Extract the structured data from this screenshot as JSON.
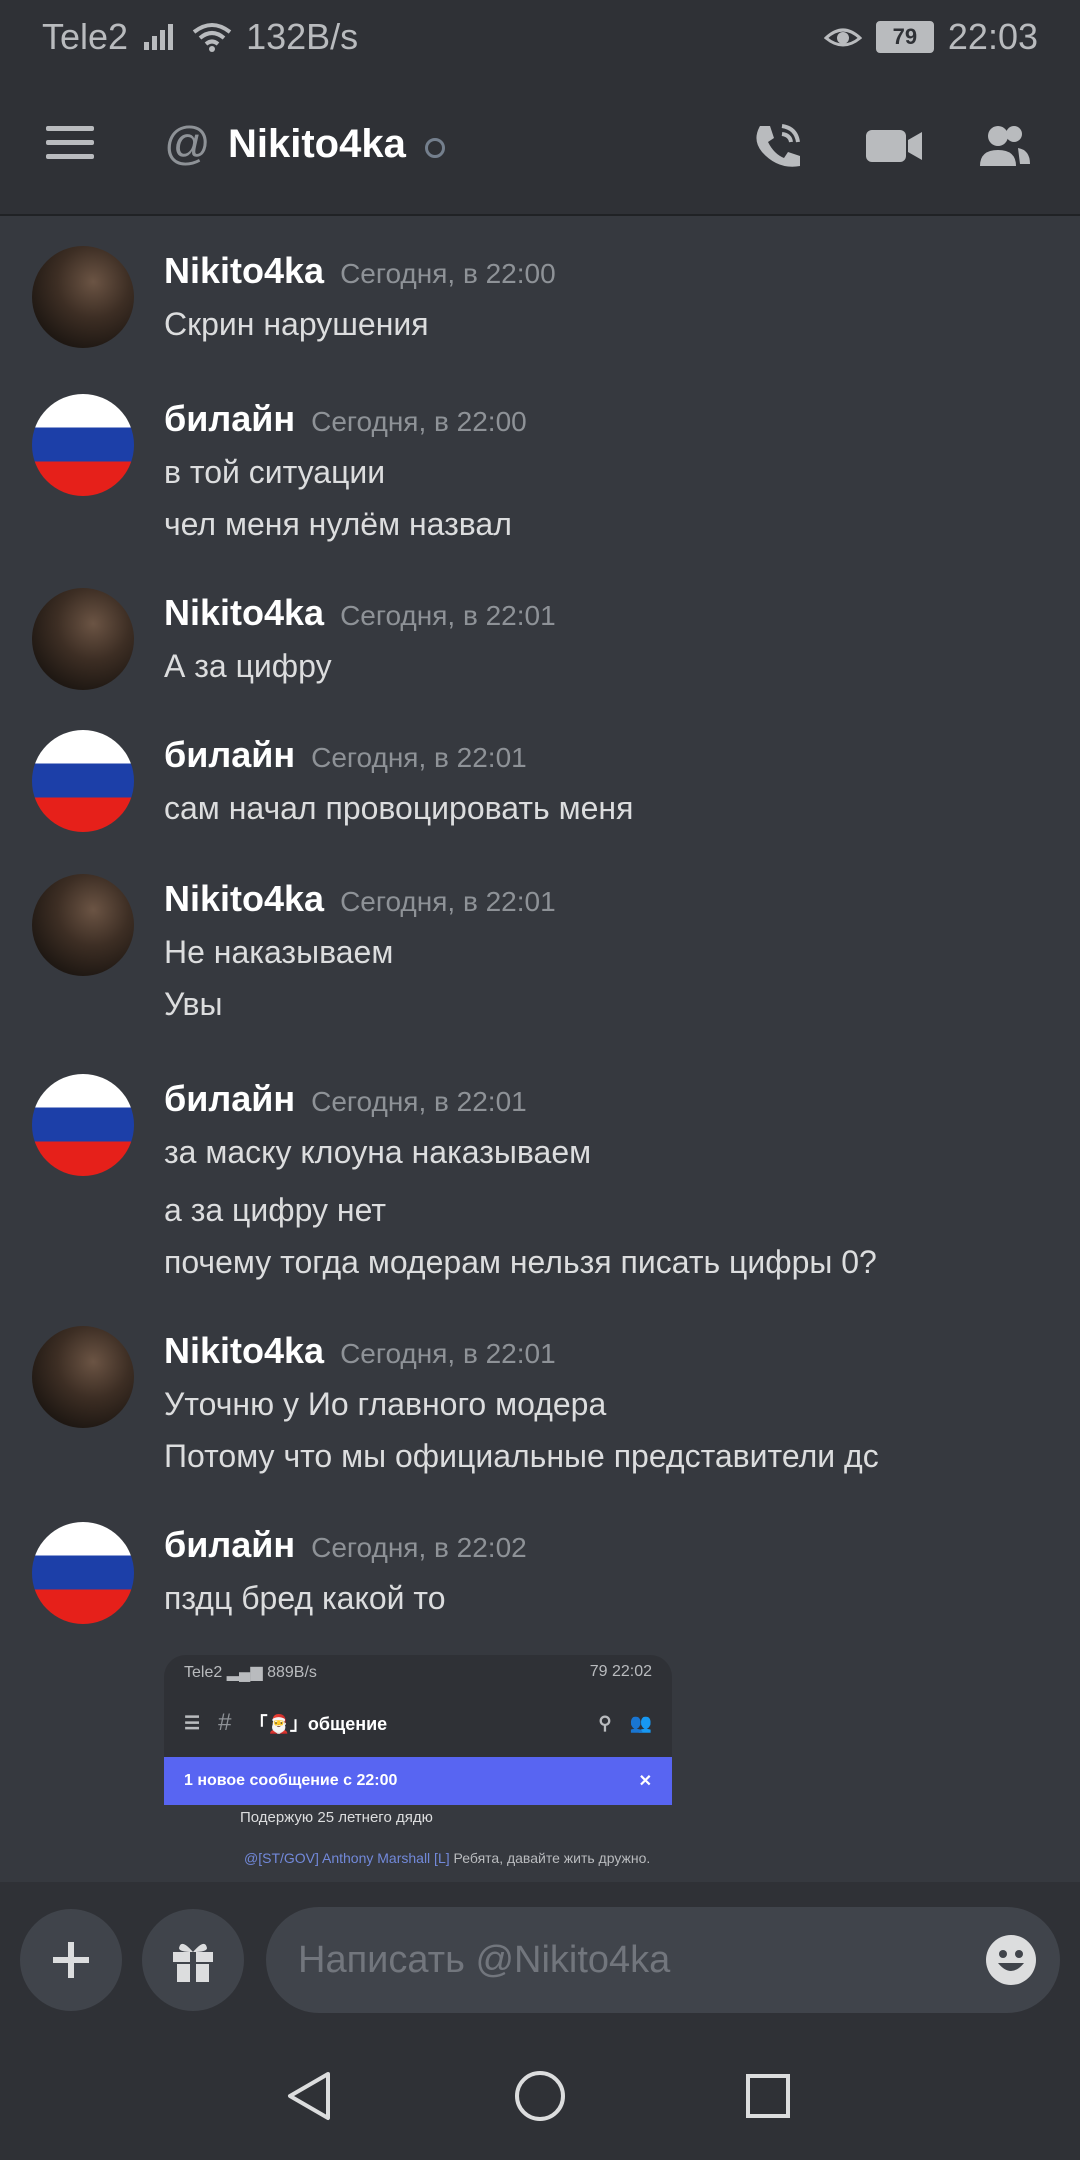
{
  "status": {
    "carrier": "Tele2",
    "net_speed": "132B/s",
    "battery": "79",
    "time": "22:03"
  },
  "header": {
    "channel_name": "Nikito4ka"
  },
  "messages": [
    {
      "author": "Nikito4ka",
      "time": "Сегодня, в 22:00",
      "lines": [
        "Скрин нарушения"
      ]
    },
    {
      "author": "билайн",
      "time": "Сегодня, в 22:00",
      "lines": [
        "в той ситуации",
        "чел меня нулём назвал"
      ]
    },
    {
      "author": "Nikito4ka",
      "time": "Сегодня, в 22:01",
      "lines": [
        "А за цифру"
      ]
    },
    {
      "author": "билайн",
      "time": "Сегодня, в 22:01",
      "lines": [
        "сам начал провоцировать меня"
      ]
    },
    {
      "author": "Nikito4ka",
      "time": "Сегодня, в 22:01",
      "lines": [
        "Не наказываем",
        "Увы"
      ]
    },
    {
      "author": "билайн",
      "time": "Сегодня, в 22:01",
      "lines": [
        "за маску клоуна наказываем",
        "а за цифру нет",
        "почему тогда модерам нельзя писать цифры 0?"
      ]
    },
    {
      "author": "Nikito4ka",
      "time": "Сегодня, в 22:01",
      "lines": [
        "Уточню у Ио главного модера",
        "Потому что мы официальные представители дс"
      ]
    },
    {
      "author": "билайн",
      "time": "Сегодня, в 22:02",
      "lines": [
        "пздц бред какой то"
      ]
    }
  ],
  "embed": {
    "carrier": "Tele2",
    "net_speed": "889B/s",
    "battery": "79",
    "time": "22:02",
    "channel": "「🎅」общение",
    "banner": "1 новое сообщение с 22:00",
    "msg_text": "Подержую 25 летнего дядю",
    "reply_author": "@[ST/GOV] Anthony Marshall [L]",
    "reply_text": "Ребята, давайте жить дружно."
  },
  "composer": {
    "placeholder": "Написать @Nikito4ka"
  }
}
